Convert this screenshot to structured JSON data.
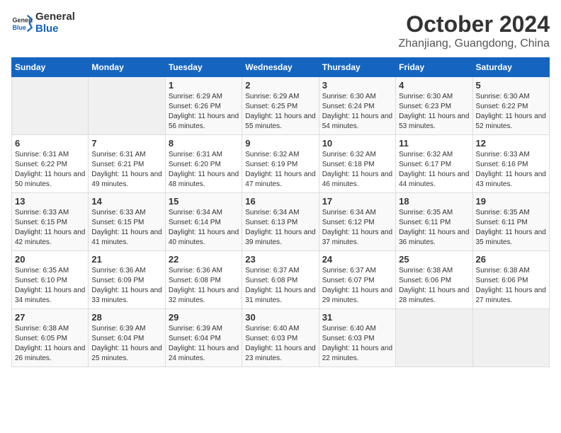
{
  "header": {
    "logo_general": "General",
    "logo_blue": "Blue",
    "title": "October 2024",
    "subtitle": "Zhanjiang, Guangdong, China"
  },
  "days_of_week": [
    "Sunday",
    "Monday",
    "Tuesday",
    "Wednesday",
    "Thursday",
    "Friday",
    "Saturday"
  ],
  "weeks": [
    [
      {
        "day": "",
        "empty": true
      },
      {
        "day": "",
        "empty": true
      },
      {
        "day": "1",
        "sunrise": "6:29 AM",
        "sunset": "6:26 PM",
        "daylight": "11 hours and 56 minutes."
      },
      {
        "day": "2",
        "sunrise": "6:29 AM",
        "sunset": "6:25 PM",
        "daylight": "11 hours and 55 minutes."
      },
      {
        "day": "3",
        "sunrise": "6:30 AM",
        "sunset": "6:24 PM",
        "daylight": "11 hours and 54 minutes."
      },
      {
        "day": "4",
        "sunrise": "6:30 AM",
        "sunset": "6:23 PM",
        "daylight": "11 hours and 53 minutes."
      },
      {
        "day": "5",
        "sunrise": "6:30 AM",
        "sunset": "6:22 PM",
        "daylight": "11 hours and 52 minutes."
      }
    ],
    [
      {
        "day": "6",
        "sunrise": "6:31 AM",
        "sunset": "6:22 PM",
        "daylight": "11 hours and 50 minutes."
      },
      {
        "day": "7",
        "sunrise": "6:31 AM",
        "sunset": "6:21 PM",
        "daylight": "11 hours and 49 minutes."
      },
      {
        "day": "8",
        "sunrise": "6:31 AM",
        "sunset": "6:20 PM",
        "daylight": "11 hours and 48 minutes."
      },
      {
        "day": "9",
        "sunrise": "6:32 AM",
        "sunset": "6:19 PM",
        "daylight": "11 hours and 47 minutes."
      },
      {
        "day": "10",
        "sunrise": "6:32 AM",
        "sunset": "6:18 PM",
        "daylight": "11 hours and 46 minutes."
      },
      {
        "day": "11",
        "sunrise": "6:32 AM",
        "sunset": "6:17 PM",
        "daylight": "11 hours and 44 minutes."
      },
      {
        "day": "12",
        "sunrise": "6:33 AM",
        "sunset": "6:16 PM",
        "daylight": "11 hours and 43 minutes."
      }
    ],
    [
      {
        "day": "13",
        "sunrise": "6:33 AM",
        "sunset": "6:15 PM",
        "daylight": "11 hours and 42 minutes."
      },
      {
        "day": "14",
        "sunrise": "6:33 AM",
        "sunset": "6:15 PM",
        "daylight": "11 hours and 41 minutes."
      },
      {
        "day": "15",
        "sunrise": "6:34 AM",
        "sunset": "6:14 PM",
        "daylight": "11 hours and 40 minutes."
      },
      {
        "day": "16",
        "sunrise": "6:34 AM",
        "sunset": "6:13 PM",
        "daylight": "11 hours and 39 minutes."
      },
      {
        "day": "17",
        "sunrise": "6:34 AM",
        "sunset": "6:12 PM",
        "daylight": "11 hours and 37 minutes."
      },
      {
        "day": "18",
        "sunrise": "6:35 AM",
        "sunset": "6:11 PM",
        "daylight": "11 hours and 36 minutes."
      },
      {
        "day": "19",
        "sunrise": "6:35 AM",
        "sunset": "6:11 PM",
        "daylight": "11 hours and 35 minutes."
      }
    ],
    [
      {
        "day": "20",
        "sunrise": "6:35 AM",
        "sunset": "6:10 PM",
        "daylight": "11 hours and 34 minutes."
      },
      {
        "day": "21",
        "sunrise": "6:36 AM",
        "sunset": "6:09 PM",
        "daylight": "11 hours and 33 minutes."
      },
      {
        "day": "22",
        "sunrise": "6:36 AM",
        "sunset": "6:08 PM",
        "daylight": "11 hours and 32 minutes."
      },
      {
        "day": "23",
        "sunrise": "6:37 AM",
        "sunset": "6:08 PM",
        "daylight": "11 hours and 31 minutes."
      },
      {
        "day": "24",
        "sunrise": "6:37 AM",
        "sunset": "6:07 PM",
        "daylight": "11 hours and 29 minutes."
      },
      {
        "day": "25",
        "sunrise": "6:38 AM",
        "sunset": "6:06 PM",
        "daylight": "11 hours and 28 minutes."
      },
      {
        "day": "26",
        "sunrise": "6:38 AM",
        "sunset": "6:06 PM",
        "daylight": "11 hours and 27 minutes."
      }
    ],
    [
      {
        "day": "27",
        "sunrise": "6:38 AM",
        "sunset": "6:05 PM",
        "daylight": "11 hours and 26 minutes."
      },
      {
        "day": "28",
        "sunrise": "6:39 AM",
        "sunset": "6:04 PM",
        "daylight": "11 hours and 25 minutes."
      },
      {
        "day": "29",
        "sunrise": "6:39 AM",
        "sunset": "6:04 PM",
        "daylight": "11 hours and 24 minutes."
      },
      {
        "day": "30",
        "sunrise": "6:40 AM",
        "sunset": "6:03 PM",
        "daylight": "11 hours and 23 minutes."
      },
      {
        "day": "31",
        "sunrise": "6:40 AM",
        "sunset": "6:03 PM",
        "daylight": "11 hours and 22 minutes."
      },
      {
        "day": "",
        "empty": true
      },
      {
        "day": "",
        "empty": true
      }
    ]
  ],
  "labels": {
    "sunrise": "Sunrise:",
    "sunset": "Sunset:",
    "daylight": "Daylight:"
  }
}
